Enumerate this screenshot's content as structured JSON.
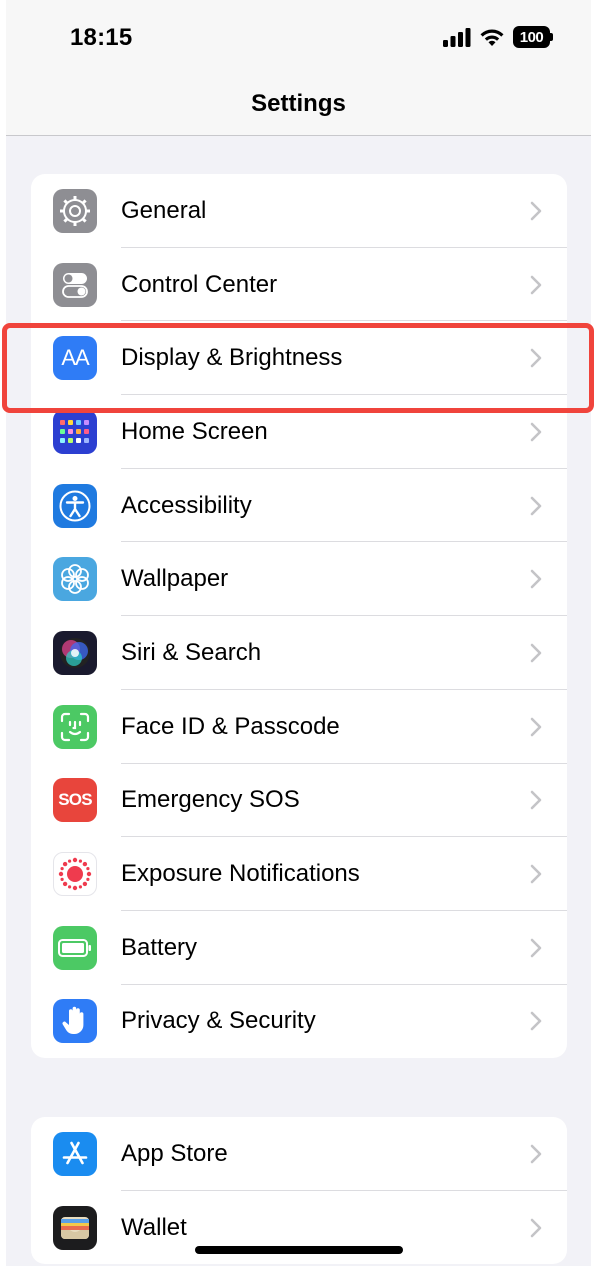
{
  "status_bar": {
    "time": "18:15",
    "battery_level": "100"
  },
  "nav": {
    "title": "Settings"
  },
  "groups": [
    {
      "items": [
        {
          "label": "General",
          "icon": "gear-icon",
          "color": "#8e8e93"
        },
        {
          "label": "Control Center",
          "icon": "toggle-switches-icon",
          "color": "#8e8e93"
        },
        {
          "label": "Display & Brightness",
          "icon": "text-size-aa-icon",
          "color": "#2f7cf6"
        },
        {
          "label": "Home Screen",
          "icon": "app-grid-icon",
          "color": "#2c3fd1"
        },
        {
          "label": "Accessibility",
          "icon": "accessibility-person-icon",
          "color": "#1f7ae0"
        },
        {
          "label": "Wallpaper",
          "icon": "flower-icon",
          "color": "#4aa7e0"
        },
        {
          "label": "Siri & Search",
          "icon": "siri-orb-icon",
          "color": "#1a1a2e"
        },
        {
          "label": "Face ID & Passcode",
          "icon": "face-id-icon",
          "color": "#4cc964"
        },
        {
          "label": "Emergency SOS",
          "icon": "sos-icon",
          "color": "#e8453c"
        },
        {
          "label": "Exposure Notifications",
          "icon": "exposure-dots-icon",
          "color": "#ffffff"
        },
        {
          "label": "Battery",
          "icon": "battery-icon",
          "color": "#4cc964"
        },
        {
          "label": "Privacy & Security",
          "icon": "hand-icon",
          "color": "#2f7cf6"
        }
      ]
    },
    {
      "items": [
        {
          "label": "App Store",
          "icon": "app-store-icon",
          "color": "#1a8cf0"
        },
        {
          "label": "Wallet",
          "icon": "wallet-icon",
          "color": "#1c1c1e"
        }
      ]
    }
  ],
  "sos_text": "SOS",
  "icon_text": "AA",
  "highlight": {
    "target": "Display & Brightness",
    "color": "#f0443c"
  }
}
